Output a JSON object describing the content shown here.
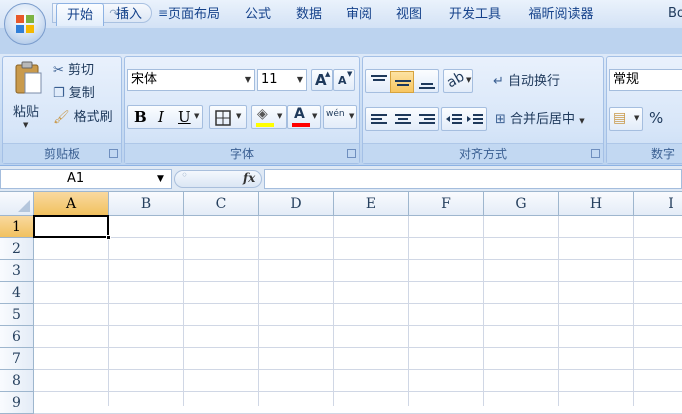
{
  "window": {
    "title": "Bo"
  },
  "qat": {
    "save_icon": "save-icon",
    "undo": "↶",
    "redo": "↷",
    "customize": "≡"
  },
  "tabs": [
    {
      "label": "开始",
      "active": true
    },
    {
      "label": "插入"
    },
    {
      "label": "页面布局"
    },
    {
      "label": "公式"
    },
    {
      "label": "数据"
    },
    {
      "label": "审阅"
    },
    {
      "label": "视图"
    },
    {
      "label": "开发工具"
    },
    {
      "label": "福昕阅读器"
    }
  ],
  "clipboard": {
    "paste": "粘贴",
    "cut": "剪切",
    "copy": "复制",
    "format_painter": "格式刷",
    "label": "剪贴板"
  },
  "font": {
    "name": "宋体",
    "size": "11",
    "grow": "A",
    "shrink": "A",
    "bold": "B",
    "italic": "I",
    "underline": "U",
    "font_color": "A",
    "phonetic": "wén",
    "label": "字体"
  },
  "alignment": {
    "wrap_text": "自动换行",
    "merge_center": "合并后居中",
    "label": "对齐方式"
  },
  "number": {
    "format": "常规",
    "percent": "%",
    "label": "数字"
  },
  "formula_bar": {
    "name_box": "A1",
    "fx": "fx",
    "value": ""
  },
  "grid": {
    "columns": [
      "A",
      "B",
      "C",
      "D",
      "E",
      "F",
      "G",
      "H",
      "I"
    ],
    "rows": [
      "1",
      "2",
      "3",
      "4",
      "5",
      "6",
      "7",
      "8",
      "9"
    ],
    "active_cell": "A1"
  },
  "colors": {
    "accent": "#15428b",
    "selected_header": "#f1c15f",
    "fill_color": "#ffff00",
    "font_color": "#ff0000"
  }
}
